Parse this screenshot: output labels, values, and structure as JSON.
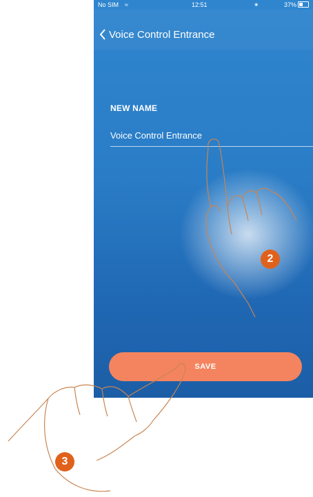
{
  "status_bar": {
    "carrier": "No SIM",
    "time": "12:51",
    "battery": "37%"
  },
  "header": {
    "title": "Voice Control Entrance"
  },
  "form": {
    "label": "NEW NAME",
    "value": "Voice Control Entrance"
  },
  "actions": {
    "save_label": "SAVE"
  },
  "annotations": {
    "step_2": "2",
    "step_3": "3"
  },
  "colors": {
    "accent": "#f4845f",
    "badge": "#e0611c",
    "background": "#2a7cc6"
  }
}
